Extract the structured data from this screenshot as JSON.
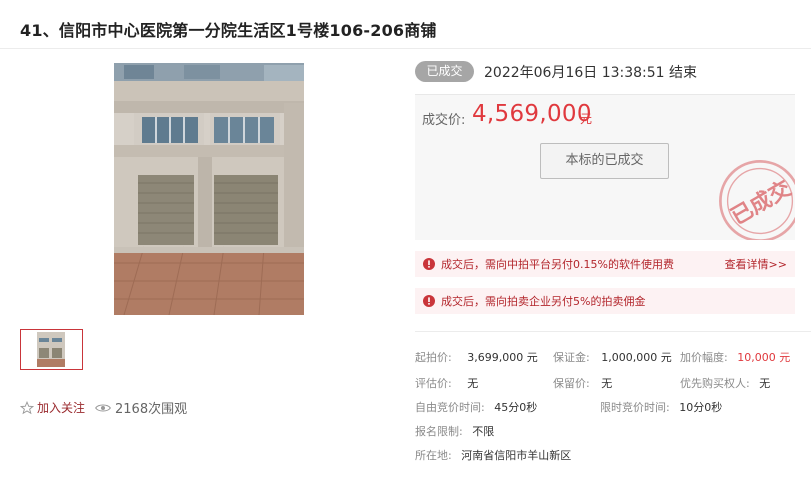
{
  "title": "41、信阳市中心医院第一分院生活区1号楼106-206商铺",
  "gallery": {
    "main_image": "storefront-photo",
    "thumbnail": "storefront-thumbnail"
  },
  "actions": {
    "follow_label": "加入关注",
    "views_label": "2168次围观"
  },
  "status": {
    "badge": "已成交",
    "end_time": "2022年06月16日  13:38:51 结束"
  },
  "price": {
    "label": "成交价:",
    "value": "4,569,000",
    "unit": "元",
    "button_label": "本标的已成交",
    "stamp_text": "已成交"
  },
  "notices": [
    {
      "text": "成交后，需向中拍平台另付0.15%的软件使用费",
      "link": "查看详情>>"
    },
    {
      "text": "成交后，需向拍卖企业另付5%的拍卖佣金"
    }
  ],
  "details": {
    "start_price_label": "起拍价:",
    "start_price": "3,699,000 元",
    "deposit_label": "保证金:",
    "deposit": "1,000,000 元",
    "increment_label": "加价幅度:",
    "increment": "10,000 元",
    "appraisal_label": "评估价:",
    "appraisal": "无",
    "reserve_label": "保留价:",
    "reserve": "无",
    "priority_label": "优先购买权人:",
    "priority": "无",
    "free_bid_label": "自由竞价时间:",
    "free_bid": "45分0秒",
    "timed_bid_label": "限时竞价时间:",
    "timed_bid": "10分0秒",
    "signup_label": "报名限制:",
    "signup": "不限",
    "location_label": "所在地:",
    "location": "河南省信阳市羊山新区"
  },
  "colors": {
    "accent_red": "#e0393e",
    "badge_gray": "#a6a6a6",
    "notice_bg": "#fdf2f3"
  }
}
